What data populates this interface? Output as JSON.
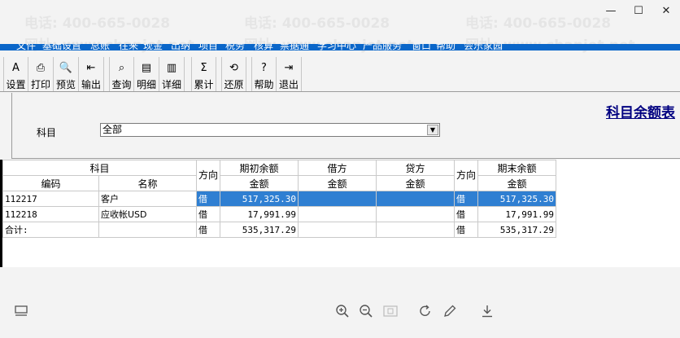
{
  "window": {
    "minimize_glyph": "—",
    "maximize_glyph": "☐",
    "close_glyph": "✕"
  },
  "menu": [
    "文件",
    "基础设置",
    "总账",
    "往来",
    "现金",
    "出纳",
    "项目",
    "税务",
    "核算",
    "票据通",
    "学习中心",
    "产品服务",
    "窗口",
    "帮助",
    "会乐家园"
  ],
  "toolbar": {
    "groups": [
      [
        {
          "id": "setup",
          "label": "设置",
          "icon": "A"
        },
        {
          "id": "print",
          "label": "打印",
          "icon": "⎙"
        },
        {
          "id": "preview",
          "label": "预览",
          "icon": "🔍"
        },
        {
          "id": "export",
          "label": "输出",
          "icon": "⇤"
        }
      ],
      [
        {
          "id": "query",
          "label": "查询",
          "icon": "⌕"
        },
        {
          "id": "detail",
          "label": "明细",
          "icon": "▤"
        },
        {
          "id": "breakdown",
          "label": "详细",
          "icon": "▥"
        }
      ],
      [
        {
          "id": "cumulative",
          "label": "累计",
          "icon": "Σ"
        }
      ],
      [
        {
          "id": "restore",
          "label": "还原",
          "icon": "⟲"
        }
      ],
      [
        {
          "id": "help",
          "label": "帮助",
          "icon": "?"
        },
        {
          "id": "exit",
          "label": "退出",
          "icon": "⇥"
        }
      ]
    ]
  },
  "report": {
    "title": "科目余额表"
  },
  "filter": {
    "label": "科目",
    "value": "全部",
    "arrow": "▼"
  },
  "grid": {
    "header": {
      "subject": "科目",
      "code": "编码",
      "name": "名称",
      "dir1": "方向",
      "opening": "期初余额",
      "debit": "借方",
      "credit": "贷方",
      "dir2": "方向",
      "closing": "期末余额",
      "amount": "金额"
    },
    "rows": [
      {
        "code": "112217",
        "name": "客户",
        "dir1": "借",
        "opening": "517,325.30",
        "debit": "",
        "credit": "",
        "dir2": "借",
        "closing": "517,325.30",
        "selected": true
      },
      {
        "code": "112218",
        "name": "应收帐USD",
        "dir1": "借",
        "opening": "17,991.99",
        "debit": "",
        "credit": "",
        "dir2": "借",
        "closing": "17,991.99",
        "selected": false
      },
      {
        "code": "合计:",
        "name": "",
        "dir1": "借",
        "opening": "535,317.29",
        "debit": "",
        "credit": "",
        "dir2": "借",
        "closing": "535,317.29",
        "selected": false
      }
    ]
  },
  "viewer_toolbar": {
    "left_icon": "layout-icon",
    "icons": [
      "zoom-in-icon",
      "zoom-out-icon",
      "fit-page-icon",
      "rotate-icon",
      "edit-icon",
      "download-icon"
    ]
  },
  "watermark": {
    "phone": "电话: 400-665-0028",
    "site": "网址: www.chanjet.net"
  }
}
